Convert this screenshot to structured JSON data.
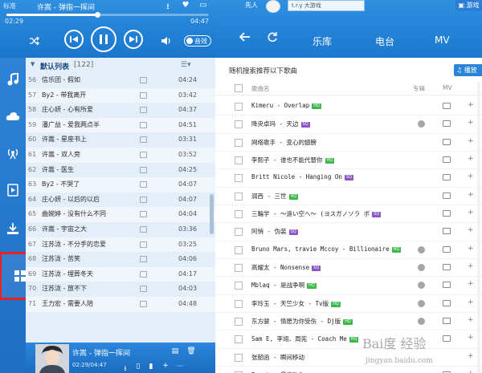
{
  "player": {
    "mode_label": "标准",
    "now_playing": "许嵩 - 弹指一挥间",
    "progress": 0.45,
    "time_current": "02:29",
    "time_total": "04:47",
    "quality_label": "音效",
    "icons": [
      "download-icon",
      "heart-icon",
      "mini-mode-icon",
      "shuffle-icon",
      "prev-icon",
      "pause-icon",
      "next-icon",
      "volume-icon"
    ]
  },
  "nav": {
    "items": [
      {
        "icon": "music-note-icon"
      },
      {
        "icon": "cloud-icon"
      },
      {
        "icon": "radio-icon"
      },
      {
        "icon": "video-icon"
      },
      {
        "icon": "download-tray-icon"
      },
      {
        "icon": "apps-grid-icon",
        "highlighted": true
      }
    ]
  },
  "playlist": {
    "name": "默认列表",
    "count": "[122]",
    "menu_icon": "list-menu-icon",
    "rows": [
      {
        "idx": "56",
        "title": "信乐团 - 假如",
        "duration": "04:24"
      },
      {
        "idx": "57",
        "title": "By2 - 带我离开",
        "duration": "03:42"
      },
      {
        "idx": "58",
        "title": "庄心妍 - 心有所爱",
        "duration": "04:37"
      },
      {
        "idx": "59",
        "title": "潘广益 - 爱我两点半",
        "duration": "04:51"
      },
      {
        "idx": "60",
        "title": "许嵩 - 星座书上",
        "duration": "03:31"
      },
      {
        "idx": "61",
        "title": "许嵩 - 双人旁",
        "duration": "03:52"
      },
      {
        "idx": "62",
        "title": "许嵩 - 医生",
        "duration": "04:25"
      },
      {
        "idx": "63",
        "title": "By2 - 不哭了",
        "duration": "04:07"
      },
      {
        "idx": "64",
        "title": "庄心妍 - 以后的以后",
        "duration": "04:07"
      },
      {
        "idx": "65",
        "title": "曲婉婷 - 没有什么不同",
        "duration": "04:04"
      },
      {
        "idx": "66",
        "title": "许嵩 - 宇宙之大",
        "duration": "03:36"
      },
      {
        "idx": "67",
        "title": "汪苏泷 - 不分手的恋爱",
        "duration": "03:25"
      },
      {
        "idx": "68",
        "title": "汪苏泷 - 苦笑",
        "duration": "04:06"
      },
      {
        "idx": "69",
        "title": "汪苏泷 - 埋葬冬天",
        "duration": "04:17"
      },
      {
        "idx": "70",
        "title": "汪苏泷 - 放不下",
        "duration": "04:03"
      },
      {
        "idx": "71",
        "title": "王力宏 - 需要人陪",
        "duration": "04:48"
      }
    ]
  },
  "mini_player": {
    "title": "许嵩 - 弹指一挥间",
    "time": "02:29/04:47"
  },
  "header": {
    "avatar_label": "先人",
    "search_value": "t.r.y 大游戏",
    "game_label": "游戏",
    "tabs": [
      {
        "label": "乐库"
      },
      {
        "label": "电台"
      },
      {
        "label": "MV"
      }
    ]
  },
  "main": {
    "rec_title": "随机搜索推荐以下歌曲",
    "play_all": "播放",
    "columns": {
      "song": "歌曲名",
      "album": "专辑",
      "mv": "MV"
    },
    "songs": [
      {
        "title": "Kimeru - Overlap",
        "badge": "HQ",
        "album": false,
        "mv": true
      },
      {
        "title": "降央卓玛 - 天边",
        "badge": "SQ",
        "album": true,
        "mv": true
      },
      {
        "title": "网络歌手 - 变心的翅膀",
        "badge": "",
        "album": false,
        "mv": true
      },
      {
        "title": "李熙子 - 谁也不能代替你",
        "badge": "HQ",
        "album": false,
        "mv": true
      },
      {
        "title": "Britt Nicole - Hanging On",
        "badge": "SQ",
        "album": false,
        "mv": true
      },
      {
        "title": "润西 - 三世",
        "badge": "HQ",
        "album": false,
        "mv": true
      },
      {
        "title": "三輪学 - ～遠い空へ～ (ヨスガノソラ ボ",
        "badge": "SQ",
        "album": false,
        "mv": true
      },
      {
        "title": "阿悄 - 伪装",
        "badge": "SQ",
        "album": false,
        "mv": true
      },
      {
        "title": "Bruno Mars, travie Mccoy - Billionaire",
        "badge": "HQ",
        "album": true,
        "mv": true
      },
      {
        "title": "高耀太 - Nonsense",
        "badge": "SQ",
        "album": true,
        "mv": true
      },
      {
        "title": "Mblaq - 是战争啊",
        "badge": "HQ",
        "album": true,
        "mv": true
      },
      {
        "title": "李玲玉 - 天竺少女 - Tv版",
        "badge": "HQ",
        "album": true,
        "mv": true
      },
      {
        "title": "东方骏 - 情愿为你受伤 - Dj版",
        "badge": "HQ",
        "album": true,
        "mv": true
      },
      {
        "title": "Sam E, 李翊、周宪 - Coach Me",
        "badge": "HQ",
        "album": false,
        "mv": true
      },
      {
        "title": "张韶函 - 瞬间移动",
        "badge": "",
        "album": false,
        "mv": false
      },
      {
        "title": "Beast - 最喜欢你",
        "badge": "HQ",
        "album": false,
        "mv": true
      }
    ]
  },
  "watermark": "jingyan.baidu.com"
}
